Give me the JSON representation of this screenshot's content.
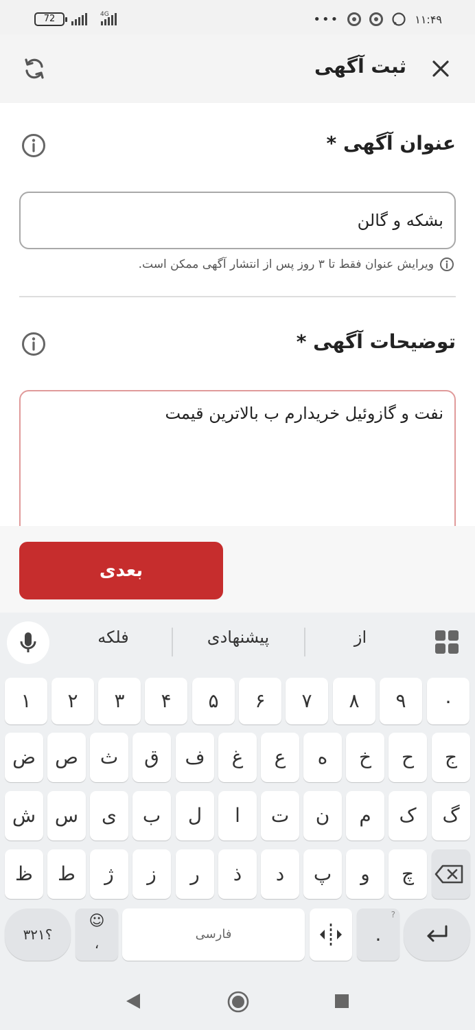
{
  "status_bar": {
    "battery": "72",
    "network": "4G",
    "time": "۱۱:۴۹",
    "overflow": "•••"
  },
  "header": {
    "title": "ثبت آگهی"
  },
  "form": {
    "title_section": {
      "label": "عنوان آگهی *",
      "value": "بشکه و گالن",
      "hint": "ویرایش عنوان فقط تا ۳ روز پس از انتشار آگهی ممکن است."
    },
    "description_section": {
      "label": "توضیحات آگهی *",
      "value": "نفت و گازوئیل خریدارم ب بالاترین قیمت"
    }
  },
  "actions": {
    "next_label": "بعدی"
  },
  "keyboard": {
    "suggestions": [
      "فلکه",
      "پیشنهادی",
      "از"
    ],
    "number_row": [
      "۱",
      "۲",
      "۳",
      "۴",
      "۵",
      "۶",
      "۷",
      "۸",
      "۹",
      "۰"
    ],
    "row1": [
      "ض",
      "ص",
      "ث",
      "ق",
      "ف",
      "غ",
      "ع",
      "ه",
      "خ",
      "ح",
      "ج"
    ],
    "row2": [
      "ش",
      "س",
      "ی",
      "ب",
      "ل",
      "ا",
      "ت",
      "ن",
      "م",
      "ک",
      "گ"
    ],
    "row3": [
      "ظ",
      "ط",
      "ژ",
      "ز",
      "ر",
      "ذ",
      "د",
      "پ",
      "و",
      "چ"
    ],
    "symbols_label": "؟۳۲۱",
    "emoji_label": "☺",
    "comma_label": "،",
    "space_label": "فارسی",
    "period_label": ".",
    "period_hint": "?"
  },
  "colors": {
    "accent": "#c62d2d",
    "desc_border": "#e09a9a"
  }
}
